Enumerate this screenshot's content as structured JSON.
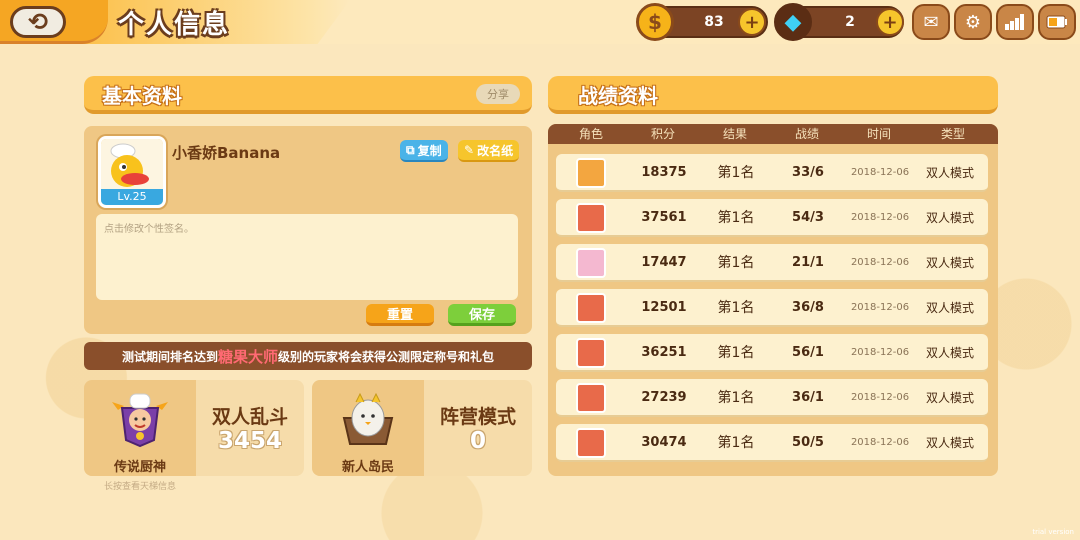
{
  "header": {
    "title": "个人信息",
    "coins": "83",
    "gems": "2"
  },
  "basic_panel": {
    "title": "基本资料",
    "share_label": "分享",
    "player_name": "小香娇Banana",
    "level": "Lv.25",
    "copy_label": "复制",
    "rename_label": "改名纸",
    "signature_placeholder": "点击修改个性签名。",
    "reset_label": "重置",
    "save_label": "保存"
  },
  "notice": {
    "prefix": "测试期间排名达到",
    "highlight": "糖果大师",
    "suffix": "级别的玩家将会获得公测限定称号和礼包"
  },
  "stats": [
    {
      "rank": "传说厨神",
      "mode": "双人乱斗",
      "score": "3454"
    },
    {
      "rank": "新人岛民",
      "mode": "阵营模式",
      "score": "0"
    }
  ],
  "hint": "长按查看天梯信息",
  "record_panel": {
    "title": "战绩资料",
    "columns": [
      "角色",
      "积分",
      "结果",
      "战绩",
      "时间",
      "类型"
    ],
    "rows": [
      {
        "score": "18375",
        "result": "第1名",
        "record": "33/6",
        "time": "2018-12-06",
        "type": "双人模式",
        "avatar_color": "#f3a640"
      },
      {
        "score": "37561",
        "result": "第1名",
        "record": "54/3",
        "time": "2018-12-06",
        "type": "双人模式",
        "avatar_color": "#e86a4a"
      },
      {
        "score": "17447",
        "result": "第1名",
        "record": "21/1",
        "time": "2018-12-06",
        "type": "双人模式",
        "avatar_color": "#f4b8d0"
      },
      {
        "score": "12501",
        "result": "第1名",
        "record": "36/8",
        "time": "2018-12-06",
        "type": "双人模式",
        "avatar_color": "#e86a4a"
      },
      {
        "score": "36251",
        "result": "第1名",
        "record": "56/1",
        "time": "2018-12-06",
        "type": "双人模式",
        "avatar_color": "#e86a4a"
      },
      {
        "score": "27239",
        "result": "第1名",
        "record": "36/1",
        "time": "2018-12-06",
        "type": "双人模式",
        "avatar_color": "#e86a4a"
      },
      {
        "score": "30474",
        "result": "第1名",
        "record": "50/5",
        "time": "2018-12-06",
        "type": "双人模式",
        "avatar_color": "#e86a4a"
      }
    ]
  },
  "version": "trial version"
}
